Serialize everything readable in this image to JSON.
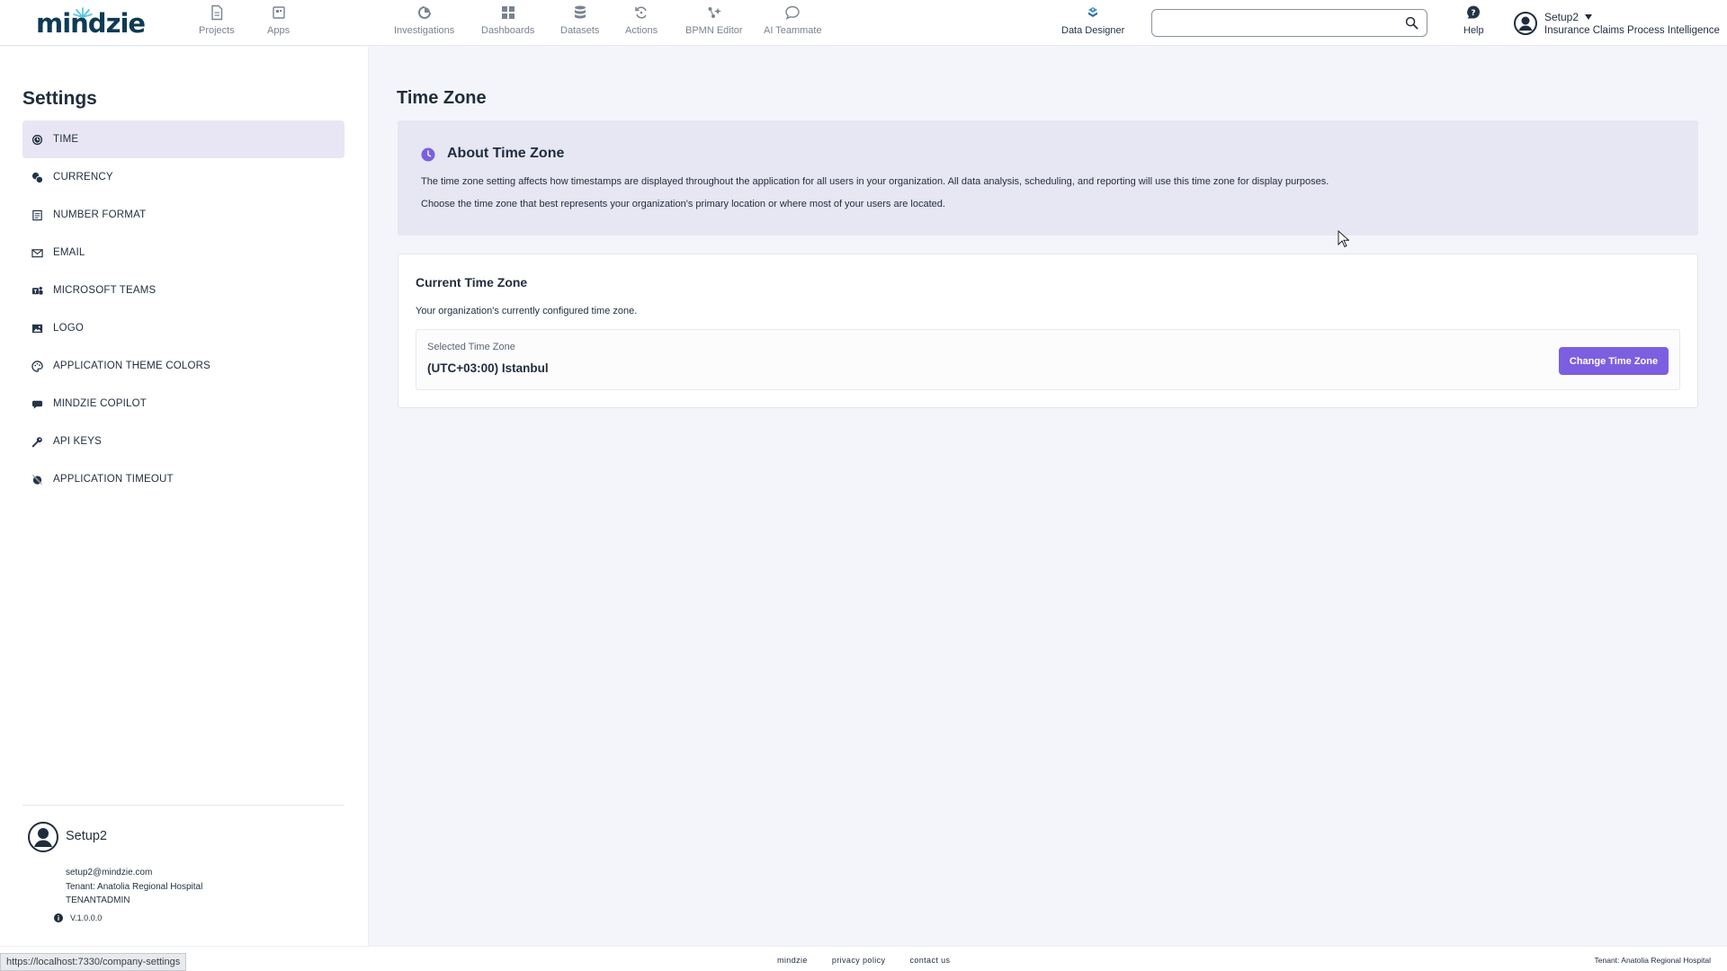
{
  "app": {
    "logo_text": "mindzie"
  },
  "nav": {
    "items": [
      {
        "label": "Projects",
        "icon": "document-icon"
      },
      {
        "label": "Apps",
        "icon": "apps-icon"
      },
      {
        "label": "Investigations",
        "icon": "investigation-icon"
      },
      {
        "label": "Dashboards",
        "icon": "dashboard-grid-icon"
      },
      {
        "label": "Datasets",
        "icon": "database-icon"
      },
      {
        "label": "Actions",
        "icon": "refresh-cycle-icon"
      },
      {
        "label": "BPMN Editor",
        "icon": "bpmn-icon"
      },
      {
        "label": "AI Teammate",
        "icon": "chat-bubble-icon"
      },
      {
        "label": "Data Designer",
        "icon": "data-designer-icon"
      }
    ],
    "help_label": "Help",
    "search_placeholder": "",
    "user_name": "Setup2",
    "project_name": "Insurance Claims Process Intelligence"
  },
  "sidebar": {
    "title": "Settings",
    "items": [
      {
        "label": "TIME",
        "icon": "clock-icon",
        "active": true
      },
      {
        "label": "CURRENCY",
        "icon": "currency-icon",
        "active": false
      },
      {
        "label": "NUMBER FORMAT",
        "icon": "number-format-icon",
        "active": false
      },
      {
        "label": "EMAIL",
        "icon": "envelope-icon",
        "active": false
      },
      {
        "label": "MICROSOFT TEAMS",
        "icon": "teams-icon",
        "active": false
      },
      {
        "label": "LOGO",
        "icon": "image-icon",
        "active": false
      },
      {
        "label": "APPLICATION THEME COLORS",
        "icon": "palette-icon",
        "active": false
      },
      {
        "label": "MINDZIE COPILOT",
        "icon": "copilot-icon",
        "active": false
      },
      {
        "label": "API KEYS",
        "icon": "key-icon",
        "active": false
      },
      {
        "label": "APPLICATION TIMEOUT",
        "icon": "timer-off-icon",
        "active": false
      }
    ],
    "footer": {
      "name": "Setup2",
      "email": "setup2@mindzie.com",
      "tenant": "Tenant: Anatolia Regional Hospital",
      "role": "TENANTADMIN",
      "version": "V.1.0.0.0"
    }
  },
  "main": {
    "title": "Time Zone",
    "about": {
      "heading": "About Time Zone",
      "p1": "The time zone setting affects how timestamps are displayed throughout the application for all users in your organization. All data analysis, scheduling, and reporting will use this time zone for display purposes.",
      "p2": "Choose the time zone that best represents your organization's primary location or where most of your users are located."
    },
    "current": {
      "heading": "Current Time Zone",
      "description": "Your organization's currently configured time zone.",
      "selected_label": "Selected Time Zone",
      "selected_value": "(UTC+03:00) Istanbul",
      "button_label": "Change Time Zone"
    }
  },
  "footer": {
    "links": [
      "mindzie",
      "privacy policy",
      "contact us"
    ],
    "tenant": "Tenant: Anatolia Regional Hospital"
  },
  "status_bar": {
    "url": "https://localhost:7330/company-settings"
  },
  "colors": {
    "accent": "#7c5fe0",
    "brand_dark": "#0e3a54",
    "active_bg": "#e8e6f5",
    "info_bg": "#e7e6f3"
  }
}
